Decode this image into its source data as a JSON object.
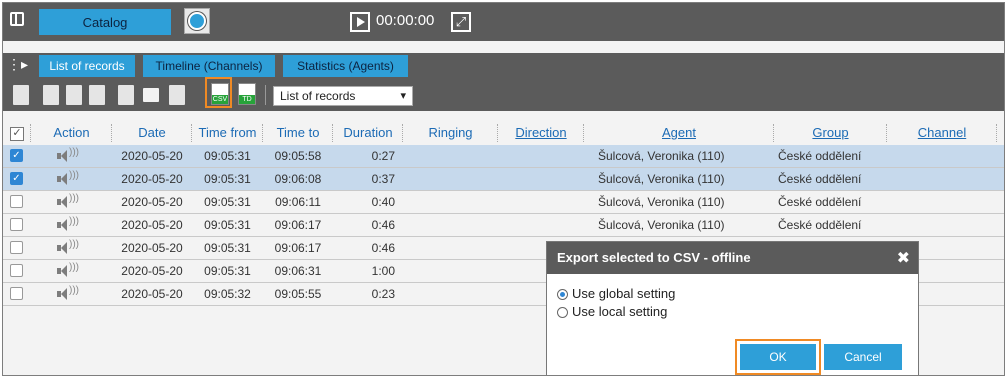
{
  "header": {
    "catalog_tab": "Catalog",
    "timer": "00:00:00"
  },
  "subtabs": [
    "List of records",
    "Timeline (Channels)",
    "Statistics (Agents)"
  ],
  "toolbar": {
    "csv_label": "CSV",
    "td_label": "TD",
    "view_select": "List of records"
  },
  "table": {
    "headers": {
      "action": "Action",
      "date": "Date",
      "time_from": "Time from",
      "time_to": "Time to",
      "duration": "Duration",
      "ringing": "Ringing",
      "direction": "Direction",
      "agent": "Agent",
      "group": "Group",
      "channel": "Channel"
    },
    "rows": [
      {
        "checked": true,
        "date": "2020-05-20",
        "from": "09:05:31",
        "to": "09:05:58",
        "duration": "0:27",
        "agent": "Šulcová, Veronika (110)",
        "group": "České oddělení"
      },
      {
        "checked": true,
        "date": "2020-05-20",
        "from": "09:05:31",
        "to": "09:06:08",
        "duration": "0:37",
        "agent": "Šulcová, Veronika (110)",
        "group": "České oddělení"
      },
      {
        "checked": false,
        "date": "2020-05-20",
        "from": "09:05:31",
        "to": "09:06:11",
        "duration": "0:40",
        "agent": "Šulcová, Veronika (110)",
        "group": "České oddělení"
      },
      {
        "checked": false,
        "date": "2020-05-20",
        "from": "09:05:31",
        "to": "09:06:17",
        "duration": "0:46",
        "agent": "Šulcová, Veronika (110)",
        "group": "České oddělení"
      },
      {
        "checked": false,
        "date": "2020-05-20",
        "from": "09:05:31",
        "to": "09:06:17",
        "duration": "0:46",
        "agent": "",
        "group": ""
      },
      {
        "checked": false,
        "date": "2020-05-20",
        "from": "09:05:31",
        "to": "09:06:31",
        "duration": "1:00",
        "agent": "",
        "group": ""
      },
      {
        "checked": false,
        "date": "2020-05-20",
        "from": "09:05:32",
        "to": "09:05:55",
        "duration": "0:23",
        "agent": "",
        "group": ""
      }
    ]
  },
  "dialog": {
    "title": "Export selected to CSV - offline",
    "close_glyph": "✖",
    "option_global": "Use global setting",
    "option_local": "Use local setting",
    "ok": "OK",
    "cancel": "Cancel"
  }
}
